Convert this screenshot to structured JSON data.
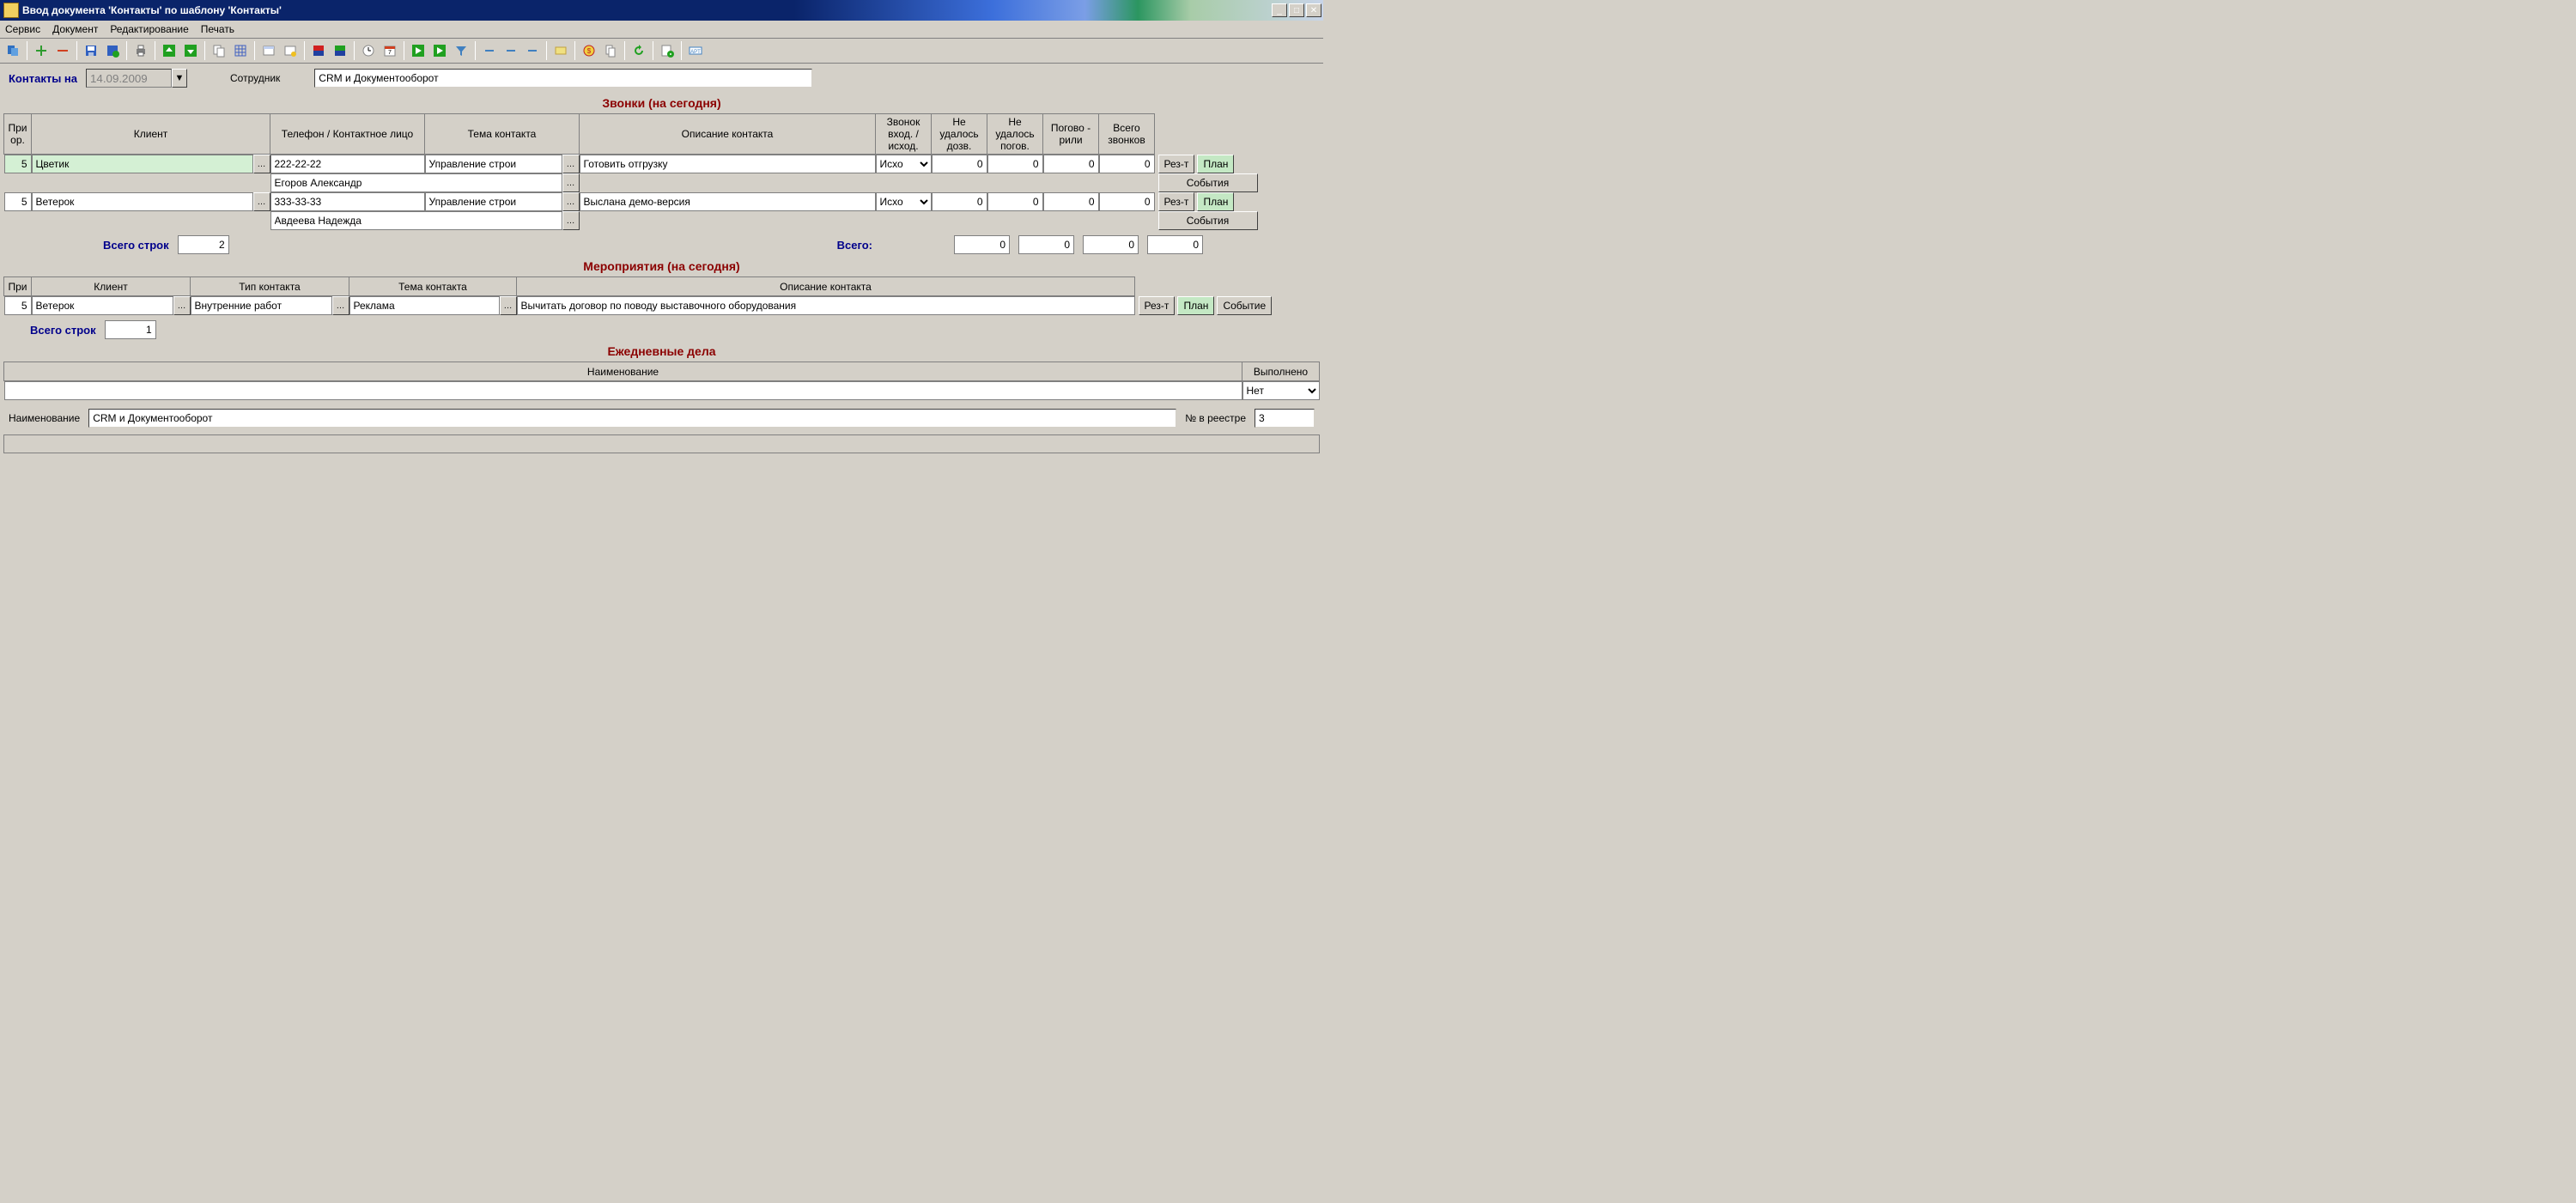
{
  "window": {
    "title": "Ввод документа 'Контакты' по шаблону 'Контакты'"
  },
  "menu": {
    "items": [
      "Сервис",
      "Документ",
      "Редактирование",
      "Печать"
    ]
  },
  "header": {
    "contacts_on": "Контакты на",
    "date": "14.09.2009",
    "employee_label": "Сотрудник",
    "employee_value": "CRM и Документооборот"
  },
  "calls": {
    "title": "Звонки (на сегодня)",
    "cols": {
      "prio": "При ор.",
      "client": "Клиент",
      "phone_contact": "Телефон        /        Контактное лицо",
      "topic": "Тема контакта",
      "desc": "Описание контакта",
      "direction": "Звонок вход. / исход.",
      "no_reach": "Не удалось дозв.",
      "no_talk": "Не удалось погов.",
      "talked": "Погово - рили",
      "total_calls": "Всего звонков"
    },
    "rows": [
      {
        "prio": "5",
        "client": "Цветик",
        "phone": "222-22-22",
        "contact_person": "Егоров Александр",
        "topic": "Управление строи",
        "desc": "Готовить отгрузку",
        "dir": "Исхо",
        "no_reach": "0",
        "no_talk": "0",
        "talked": "0",
        "total": "0"
      },
      {
        "prio": "5",
        "client": "Ветерок",
        "phone": "333-33-33",
        "contact_person": "Авдеева Надежда",
        "topic": "Управление строи",
        "desc": "Выслана демо-версия",
        "dir": "Исхо",
        "no_reach": "0",
        "no_talk": "0",
        "talked": "0",
        "total": "0"
      }
    ],
    "totals": {
      "rows_label": "Всего строк",
      "rows_value": "2",
      "sum_label": "Всего:",
      "no_reach": "0",
      "no_talk": "0",
      "talked": "0",
      "total": "0"
    },
    "buttons": {
      "result": "Рез-т",
      "plan": "План",
      "events": "События"
    }
  },
  "events": {
    "title": "Мероприятия (на сегодня)",
    "cols": {
      "prio": "При",
      "client": "Клиент",
      "type": "Тип контакта",
      "topic": "Тема контакта",
      "desc": "Описание контакта"
    },
    "row": {
      "prio": "5",
      "client": "Ветерок",
      "type": "Внутренние работ",
      "topic": "Реклама",
      "desc": "Вычитать договор по поводу выставочного оборудования"
    },
    "totals": {
      "rows_label": "Всего строк",
      "rows_value": "1"
    },
    "buttons": {
      "result": "Рез-т",
      "plan": "План",
      "event": "Событие"
    }
  },
  "daily": {
    "title": "Ежедневные дела",
    "cols": {
      "name": "Наименование",
      "done": "Выполнено"
    },
    "row": {
      "name": "",
      "done": "Нет"
    }
  },
  "footer": {
    "name_label": "Наименование",
    "name_value": "CRM и Документооборот",
    "reg_label": "№ в реестре",
    "reg_value": "3"
  }
}
